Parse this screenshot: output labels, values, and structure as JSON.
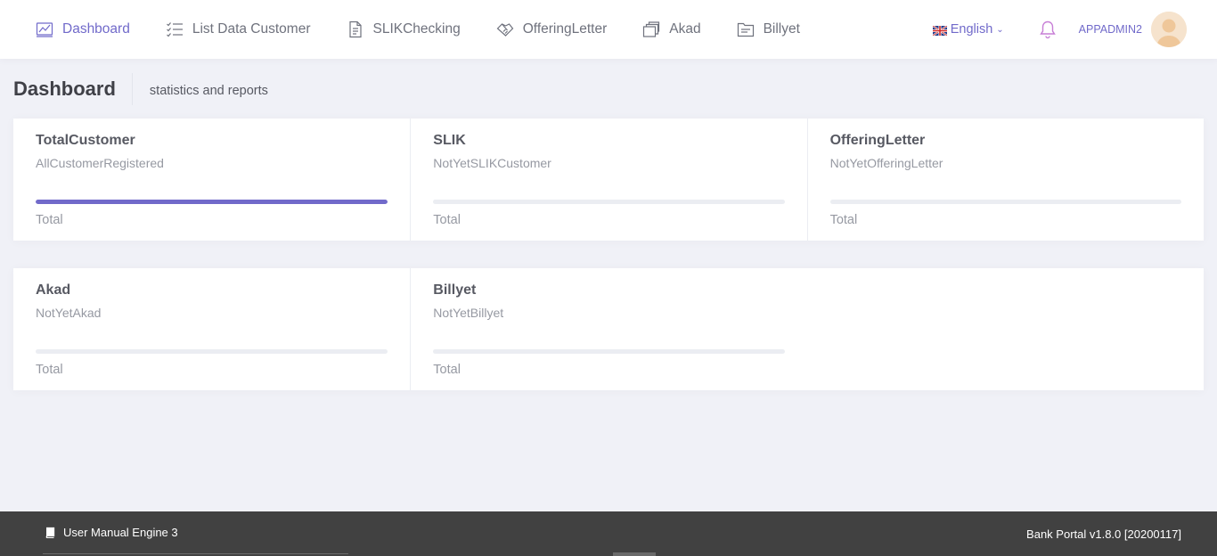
{
  "nav": {
    "items": [
      {
        "label": "Dashboard",
        "icon": "chart-icon",
        "active": true
      },
      {
        "label": "List Data Customer",
        "icon": "checklist-icon",
        "active": false
      },
      {
        "label": "SLIKChecking",
        "icon": "document-icon",
        "active": false
      },
      {
        "label": "OfferingLetter",
        "icon": "handshake-icon",
        "active": false
      },
      {
        "label": "Akad",
        "icon": "stack-icon",
        "active": false
      },
      {
        "label": "Billyet",
        "icon": "folder-icon",
        "active": false
      }
    ]
  },
  "topbar": {
    "language": "English",
    "language_flag": "uk-flag-icon",
    "username": "APPADMIN2"
  },
  "subheader": {
    "title": "Dashboard",
    "description": "statistics and reports"
  },
  "stats": [
    {
      "title": "TotalCustomer",
      "description": "AllCustomerRegistered",
      "total_label": "Total",
      "progress": 1.0
    },
    {
      "title": "SLIK",
      "description": "NotYetSLIKCustomer",
      "total_label": "Total",
      "progress": 0
    },
    {
      "title": "OfferingLetter",
      "description": "NotYetOfferingLetter",
      "total_label": "Total",
      "progress": 0
    },
    {
      "title": "Akad",
      "description": "NotYetAkad",
      "total_label": "Total",
      "progress": 0
    },
    {
      "title": "Billyet",
      "description": "NotYetBillyet",
      "total_label": "Total",
      "progress": 0
    }
  ],
  "footer": {
    "manual_label": "User Manual Engine 3",
    "version": "Bank Portal v1.8.0 [20200117]"
  },
  "colors": {
    "accent": "#716aca",
    "footer_bg": "#414141",
    "page_bg": "#f0f1f7"
  }
}
